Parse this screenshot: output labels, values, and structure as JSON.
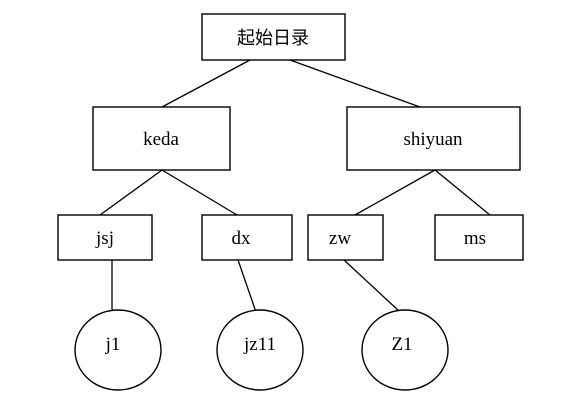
{
  "tree": {
    "root": {
      "label": "起始日录"
    },
    "level1": [
      {
        "label": "keda"
      },
      {
        "label": "shiyuan"
      }
    ],
    "level2": [
      {
        "label": "jsj"
      },
      {
        "label": "dx"
      },
      {
        "label": "zw"
      },
      {
        "label": "ms"
      }
    ],
    "leaves": [
      {
        "label": "j1"
      },
      {
        "label": "jz11"
      },
      {
        "label": "Z1"
      }
    ]
  }
}
